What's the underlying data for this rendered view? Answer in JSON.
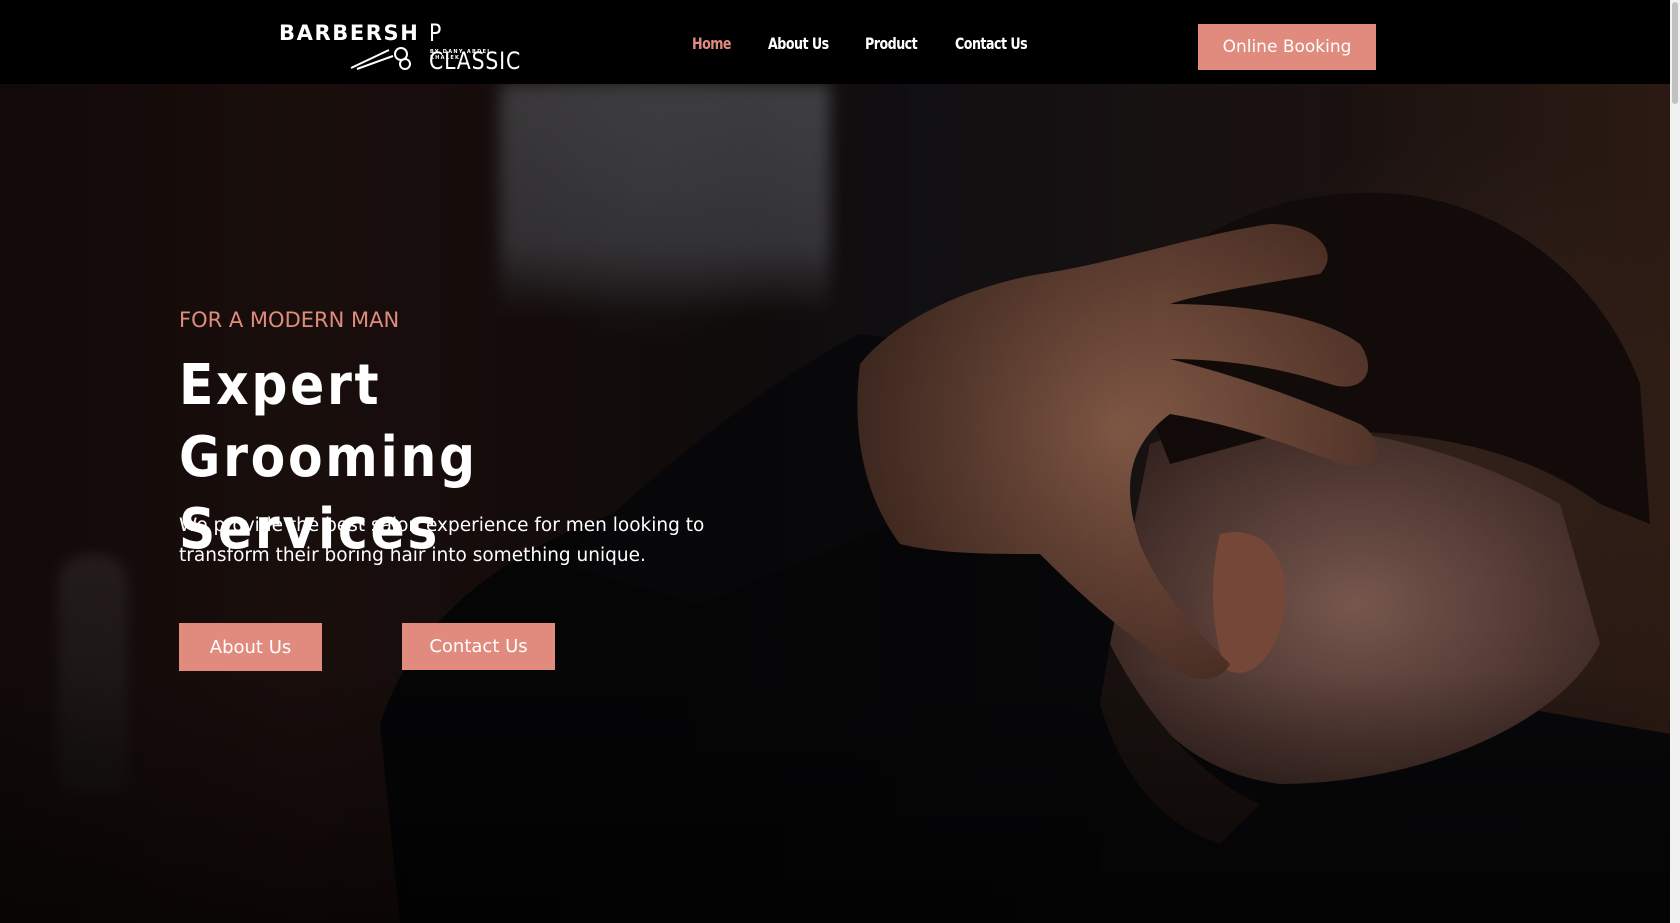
{
  "header": {
    "logo": {
      "word_a": "BARBERSH",
      "word_b": "P CLASSIC",
      "tagline": "BY DANY ABDEL KHALEK",
      "icon": "scissors-icon"
    },
    "nav": [
      {
        "label": "Home",
        "active": true
      },
      {
        "label": "About Us",
        "active": false
      },
      {
        "label": "Product",
        "active": false
      },
      {
        "label": "Contact Us",
        "active": false
      }
    ],
    "booking_label": "Online Booking"
  },
  "hero": {
    "eyebrow": "FOR A MODERN MAN",
    "headline_line1": "Expert Grooming",
    "headline_line2": "Services",
    "description": "We provide the best salon experience for men looking to transform their boring hair into something unique.",
    "about_label": "About Us",
    "contact_label": "Contact Us"
  },
  "colors": {
    "accent": "#e08b7e",
    "header_bg": "#000000",
    "text_light": "#ffffff"
  }
}
